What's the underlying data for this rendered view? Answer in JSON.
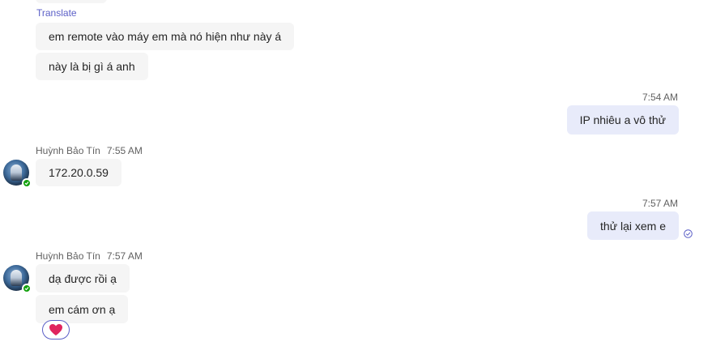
{
  "chat": {
    "translate_link": "Translate",
    "messages": [
      {
        "text": "em remote vào máy em mà nó hiện như này á"
      },
      {
        "text": "này là bị gì á anh"
      },
      {
        "time": "7:54 AM",
        "text": "IP nhiêu a vô thử"
      },
      {
        "sender": "Huỳnh Bảo Tín",
        "time": "7:55 AM",
        "text": "172.20.0.59"
      },
      {
        "time": "7:57 AM",
        "text": "thử lại xem e"
      },
      {
        "sender": "Huỳnh Bảo Tín",
        "time": "7:57 AM",
        "text": "dạ được rồi ạ"
      },
      {
        "text": "em cám ơn ạ"
      }
    ],
    "reaction": {
      "icon": "heart-icon",
      "color": "#e0245e"
    },
    "status_color": "#13a10e",
    "accent": "#5b5fc7"
  }
}
